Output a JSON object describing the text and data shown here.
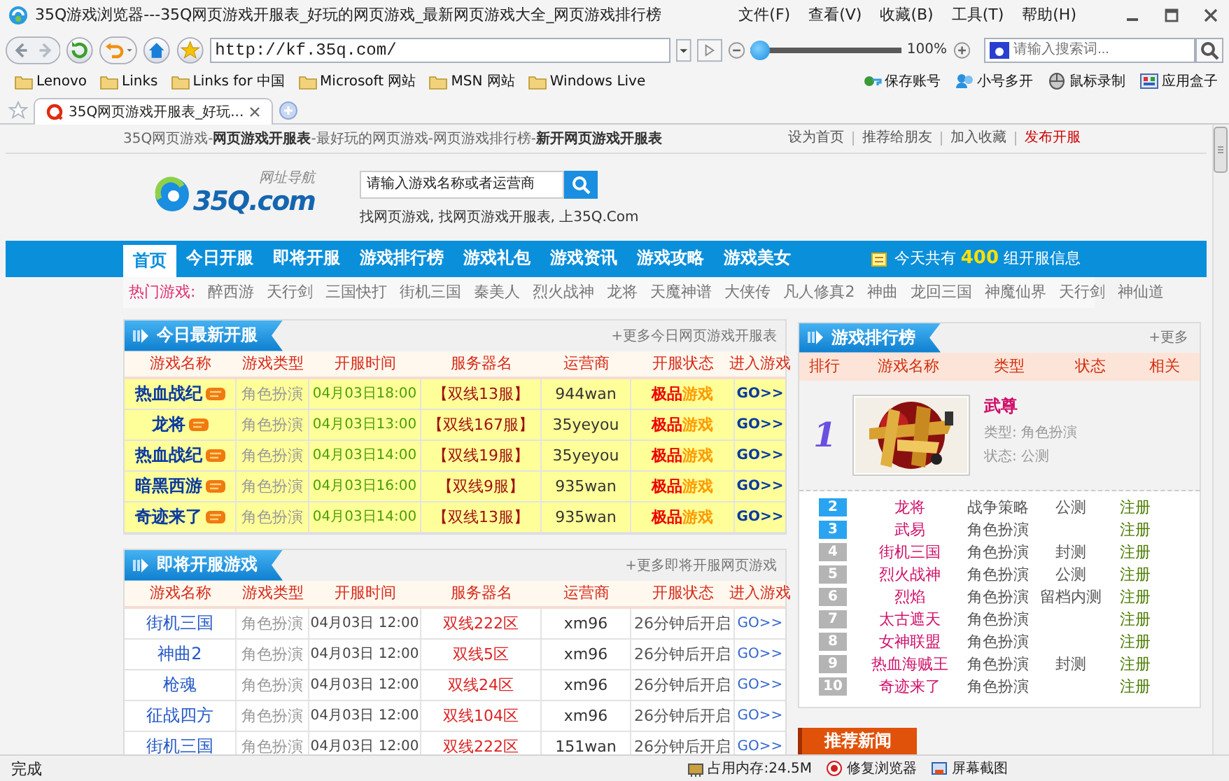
{
  "window": {
    "title": "35Q游戏浏览器---35Q网页游戏开服表_好玩的网页游戏_最新网页游戏大全_网页游戏排行榜"
  },
  "menu": [
    "文件(F)",
    "查看(V)",
    "收藏(B)",
    "工具(T)",
    "帮助(H)"
  ],
  "toolbar": {
    "address": "http://kf.35q.com/",
    "zoom": {
      "level": 0,
      "reading": "100%"
    },
    "search": {
      "placeholder": "请输入搜索词..."
    }
  },
  "bookmarks": [
    "Lenovo",
    "Links",
    "Links for 中国",
    "Microsoft 网站",
    "MSN 网站",
    "Windows Live"
  ],
  "tools": [
    "保存账号",
    "小号多开",
    "鼠标录制",
    "应用盒子"
  ],
  "tabs": [
    {
      "label": "35Q网页游戏开服表_好玩...",
      "selected": true
    }
  ],
  "page": {
    "top_bar": {
      "tagline": "35Q网页游戏-**网页游戏开服表**-最好玩的网页游戏-网页游戏排行榜-**新开网页游戏开服表**",
      "links": [
        {
          "label": "设为首页",
          "color": "#555555"
        },
        {
          "label": "推荐给朋友",
          "color": "#555555"
        },
        {
          "label": "加入收藏",
          "color": "#555555"
        },
        {
          "label": "发布开服",
          "color": "#cc0000"
        }
      ]
    },
    "header": {
      "logo": "35Q.com",
      "logo_caption": "网址导航",
      "search": {
        "placeholder": "请输入游戏名称或者运营商"
      },
      "slogan": "找网页游戏, 找网页游戏开服表, 上35Q.Com"
    },
    "nav": {
      "items": [
        {
          "label": "首页",
          "selected": true
        },
        {
          "label": "今日开服",
          "selected": false
        },
        {
          "label": "即将开服",
          "selected": false
        },
        {
          "label": "游戏排行榜",
          "selected": false
        },
        {
          "label": "游戏礼包",
          "selected": false
        },
        {
          "label": "游戏资讯",
          "selected": false
        },
        {
          "label": "游戏攻略",
          "selected": false
        },
        {
          "label": "游戏美女",
          "selected": false
        }
      ],
      "info": "今天共有 **400** 组开服信息"
    },
    "hot_games": {
      "label": "热门游戏:",
      "games": [
        "醉西游",
        "天行剑",
        "三国快打",
        "街机三国",
        "秦美人",
        "烈火战神",
        "龙将",
        "天魔神谱",
        "大侠传",
        "凡人修真2",
        "神曲",
        "龙回三国",
        "神魔仙界",
        "天行剑",
        "神仙道"
      ]
    },
    "today": {
      "title": "今日最新开服",
      "more": "+更多今日网页游戏开服表",
      "columns": [
        "游戏名称",
        "游戏类型",
        "开服时间",
        "服务器名",
        "运营商",
        "开服状态",
        "进入游戏"
      ],
      "rows": [
        {
          "name": "热血战纪",
          "new": true,
          "highlighted": true,
          "type": "角色扮演",
          "time": "04月03日18:00",
          "server": "【双线13服】",
          "operator": "944wan",
          "status": "**极品**游戏",
          "go": "GO>>"
        },
        {
          "name": "龙将",
          "new": true,
          "highlighted": true,
          "type": "角色扮演",
          "time": "04月03日13:00",
          "server": "【双线167服】",
          "operator": "35yeyou",
          "status": "**极品**游戏",
          "go": "GO>>"
        },
        {
          "name": "热血战纪",
          "new": true,
          "highlighted": true,
          "type": "角色扮演",
          "time": "04月03日14:00",
          "server": "【双线19服】",
          "operator": "35yeyou",
          "status": "**极品**游戏",
          "go": "GO>>"
        },
        {
          "name": "暗黑西游",
          "new": true,
          "highlighted": true,
          "type": "角色扮演",
          "time": "04月03日16:00",
          "server": "【双线9服】",
          "operator": "935wan",
          "status": "**极品**游戏",
          "go": "GO>>"
        },
        {
          "name": "奇迹来了",
          "new": true,
          "highlighted": true,
          "type": "角色扮演",
          "time": "04月03日14:00",
          "server": "【双线13服】",
          "operator": "935wan",
          "status": "**极品**游戏",
          "go": "GO>>"
        }
      ]
    },
    "upcoming": {
      "title": "即将开服游戏",
      "more": "+更多即将开服网页游戏",
      "columns": [
        "游戏名称",
        "游戏类型",
        "开服时间",
        "服务器名",
        "运营商",
        "开服状态",
        "进入游戏"
      ],
      "rows": [
        {
          "name": "街机三国",
          "new": false,
          "highlighted": false,
          "type": "角色扮演",
          "time": "04月03日 12:00",
          "server": "双线222区",
          "operator": "xm96",
          "status": "26分钟后开启",
          "go": "GO>>"
        },
        {
          "name": "神曲2",
          "new": false,
          "highlighted": false,
          "type": "角色扮演",
          "time": "04月03日 12:00",
          "server": "双线5区",
          "operator": "xm96",
          "status": "26分钟后开启",
          "go": "GO>>"
        },
        {
          "name": "枪魂",
          "new": false,
          "highlighted": false,
          "type": "角色扮演",
          "time": "04月03日 12:00",
          "server": "双线24区",
          "operator": "xm96",
          "status": "26分钟后开启",
          "go": "GO>>"
        },
        {
          "name": "征战四方",
          "new": false,
          "highlighted": false,
          "type": "角色扮演",
          "time": "04月03日 12:00",
          "server": "双线104区",
          "operator": "xm96",
          "status": "26分钟后开启",
          "go": "GO>>"
        },
        {
          "name": "街机三国",
          "new": false,
          "highlighted": false,
          "type": "角色扮演",
          "time": "04月03日 12:00",
          "server": "双线222区",
          "operator": "151wan",
          "status": "26分钟后开启",
          "go": "GO>>"
        }
      ]
    },
    "ranking": {
      "title": "游戏排行榜",
      "more": "+更多",
      "columns": [
        "排行",
        "游戏名称",
        "类型",
        "状态",
        "相关"
      ],
      "top": {
        "rank": "1",
        "name": "武尊",
        "type": "类型: 角色扮演",
        "status": "状态: 公测"
      },
      "rows": [
        {
          "rank": "2",
          "color": "#2aa4f0",
          "name": "龙将",
          "type": "战争策略",
          "status": "公测",
          "action": "注册"
        },
        {
          "rank": "3",
          "color": "#2aa4f0",
          "name": "武易",
          "type": "角色扮演",
          "action": "注册"
        },
        {
          "rank": "4",
          "color": "#b4b4b4",
          "name": "街机三国",
          "type": "角色扮演",
          "status": "封测",
          "action": "注册"
        },
        {
          "rank": "5",
          "color": "#b4b4b4",
          "name": "烈火战神",
          "type": "角色扮演",
          "status": "公测",
          "action": "注册"
        },
        {
          "rank": "6",
          "color": "#b4b4b4",
          "name": "烈焰",
          "type": "角色扮演",
          "status": "留档内测",
          "action": "注册"
        },
        {
          "rank": "7",
          "color": "#b4b4b4",
          "name": "太古遮天",
          "type": "角色扮演",
          "action": "注册"
        },
        {
          "rank": "8",
          "color": "#b4b4b4",
          "name": "女神联盟",
          "type": "角色扮演",
          "action": "注册"
        },
        {
          "rank": "9",
          "color": "#b4b4b4",
          "name": "热血海贼王",
          "type": "角色扮演",
          "status": "封测",
          "action": "注册"
        },
        {
          "rank": "10",
          "color": "#b4b4b4",
          "name": "奇迹来了",
          "type": "角色扮演",
          "action": "注册"
        }
      ]
    },
    "news": {
      "title": "推荐新闻"
    }
  },
  "status_bar": {
    "status": "完成",
    "items": [
      "占用内存:24.5M",
      "修复浏览器",
      "屏幕截图"
    ]
  }
}
